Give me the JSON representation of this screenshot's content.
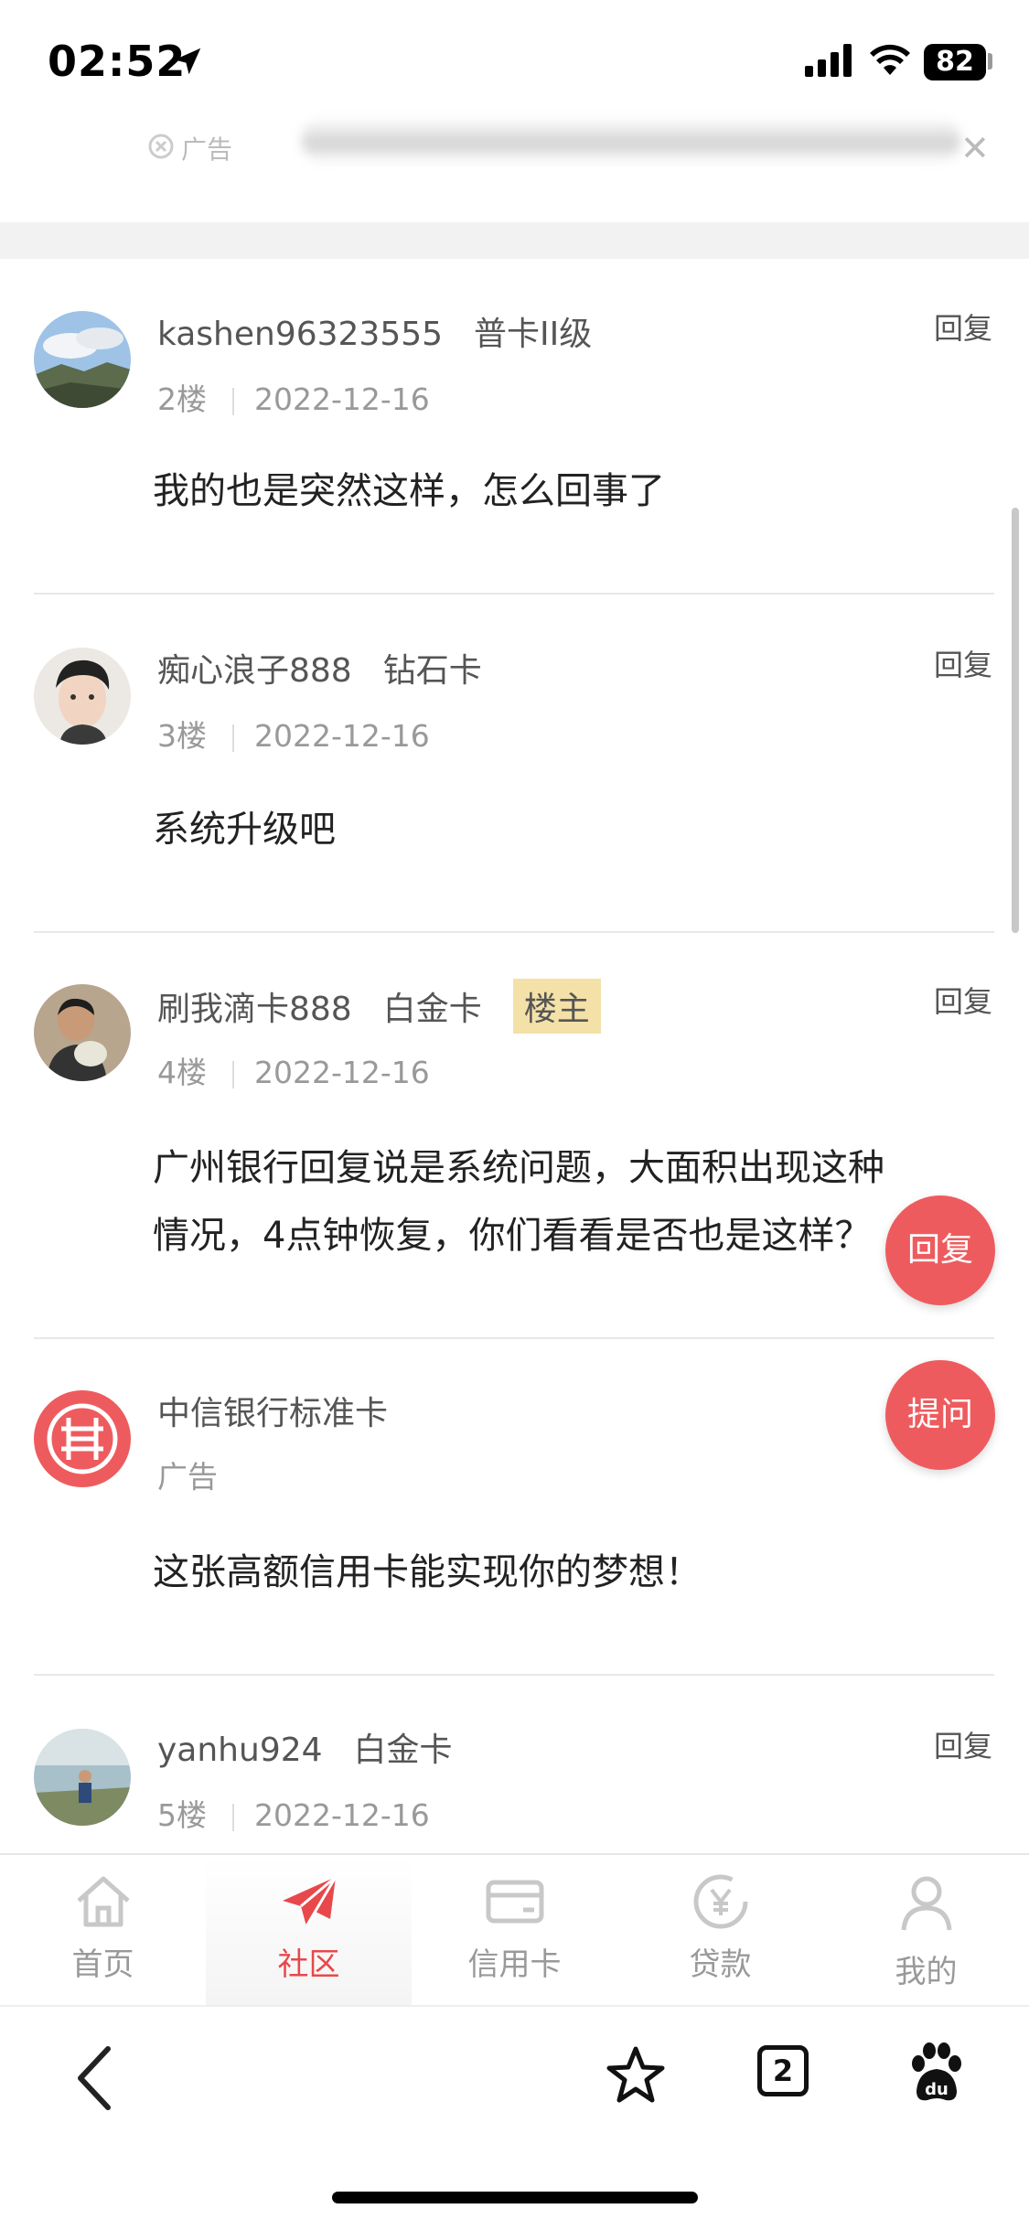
{
  "status_bar": {
    "time": "02:52",
    "battery": "82"
  },
  "top_ad": {
    "label": "广告"
  },
  "posts": [
    {
      "username": "kashen96323555",
      "level": "普卡II级",
      "floor": "2楼",
      "date": "2022-12-16",
      "reply": "回复",
      "content": "我的也是突然这样，怎么回事了"
    },
    {
      "username": "痴心浪子888",
      "level": "钻石卡",
      "floor": "3楼",
      "date": "2022-12-16",
      "reply": "回复",
      "content": "系统升级吧"
    },
    {
      "username": "刷我滴卡888",
      "level": "白金卡",
      "badge": "楼主",
      "floor": "4楼",
      "date": "2022-12-16",
      "reply": "回复",
      "content_line1": "广州银行回复说是系统问题，大面积出现这种",
      "content_line2": "情况，4点钟恢复，你们看看是否也是这样？"
    }
  ],
  "ad_post": {
    "name": "中信银行标准卡",
    "label": "广告",
    "content": "这张高额信用卡能实现你的梦想！"
  },
  "post5": {
    "username": "yanhu924",
    "level": "白金卡",
    "floor": "5楼",
    "date": "2022-12-16",
    "reply": "回复"
  },
  "fab": {
    "reply": "回复",
    "ask": "提问"
  },
  "tabs": [
    {
      "label": "首页",
      "icon": "home-icon"
    },
    {
      "label": "社区",
      "icon": "paper-plane-icon",
      "active": true
    },
    {
      "label": "信用卡",
      "icon": "credit-card-icon"
    },
    {
      "label": "贷款",
      "icon": "yen-coin-icon"
    },
    {
      "label": "我的",
      "icon": "user-icon"
    }
  ],
  "browser": {
    "tab_count": "2"
  },
  "colors": {
    "accent": "#ee5b5e",
    "badge_bg": "#f4e1a8",
    "tab_active": "#e8484b"
  }
}
